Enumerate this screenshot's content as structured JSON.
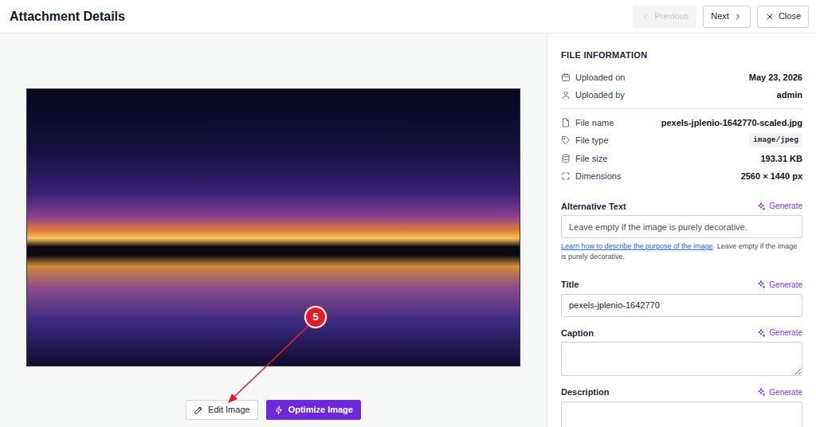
{
  "header": {
    "title": "Attachment Details",
    "buttons": [
      {
        "label": "Previous",
        "disabled": true
      },
      {
        "label": "Next",
        "disabled": false
      },
      {
        "label": "Close",
        "disabled": false
      }
    ]
  },
  "annotation": {
    "number": "5"
  },
  "actions": [
    {
      "label": "Edit Image",
      "kind": "secondary"
    },
    {
      "label": "Optimize Image",
      "kind": "primary"
    }
  ],
  "file_info": {
    "heading": "FILE INFORMATION",
    "groups": [
      {
        "rows": [
          {
            "label": "Uploaded on",
            "value": "May 23, 2026",
            "kind": "plain"
          },
          {
            "label": "Uploaded by",
            "value": "admin",
            "kind": "plain"
          }
        ]
      },
      {
        "rows": [
          {
            "label": "File name",
            "value": "pexels-jplenio-1642770-scaled.jpg",
            "kind": "plain"
          },
          {
            "label": "File type",
            "value": "image/jpeg",
            "kind": "code"
          },
          {
            "label": "File size",
            "value": "193.31 KB",
            "kind": "plain"
          },
          {
            "label": "Dimensions",
            "value": "2560 × 1440 px",
            "kind": "plain"
          }
        ]
      }
    ]
  },
  "fields": [
    {
      "label": "Alternative Text",
      "generate": "Generate",
      "kind": "input",
      "placeholder": "Leave empty if the image is purely decorative.",
      "help_link": "Learn how to describe the purpose of the image",
      "help_rest": ". Leave empty if the image is purely decorative."
    },
    {
      "label": "Title",
      "generate": "Generate",
      "kind": "input",
      "value": "pexels-jplenio-1642770"
    },
    {
      "label": "Caption",
      "generate": "Generate",
      "kind": "textarea",
      "value": ""
    },
    {
      "label": "Description",
      "generate": "Generate",
      "kind": "textarea",
      "value": ""
    }
  ]
}
